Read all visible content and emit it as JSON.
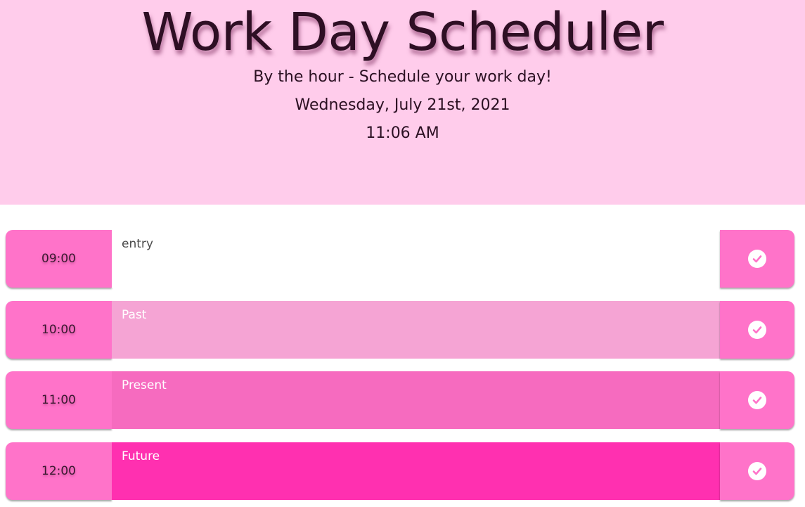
{
  "header": {
    "title": "Work Day Scheduler",
    "subtitle": "By the hour - Schedule your work day!",
    "date": "Wednesday, July 21st, 2021",
    "time": "11:06 AM"
  },
  "colors": {
    "header_bg": "#ffcceb",
    "hour_bg": "#ff73c9",
    "past": "#f5a4d4",
    "present": "#f66bbf",
    "future": "#ff30b0"
  },
  "rows": [
    {
      "hour": "09:00",
      "text": "entry",
      "state": "entry",
      "save_icon": "check-circle-icon"
    },
    {
      "hour": "10:00",
      "text": "Past",
      "state": "past",
      "save_icon": "check-circle-icon"
    },
    {
      "hour": "11:00",
      "text": "Present",
      "state": "present",
      "save_icon": "check-circle-icon"
    },
    {
      "hour": "12:00",
      "text": "Future",
      "state": "future",
      "save_icon": "check-circle-icon"
    }
  ]
}
